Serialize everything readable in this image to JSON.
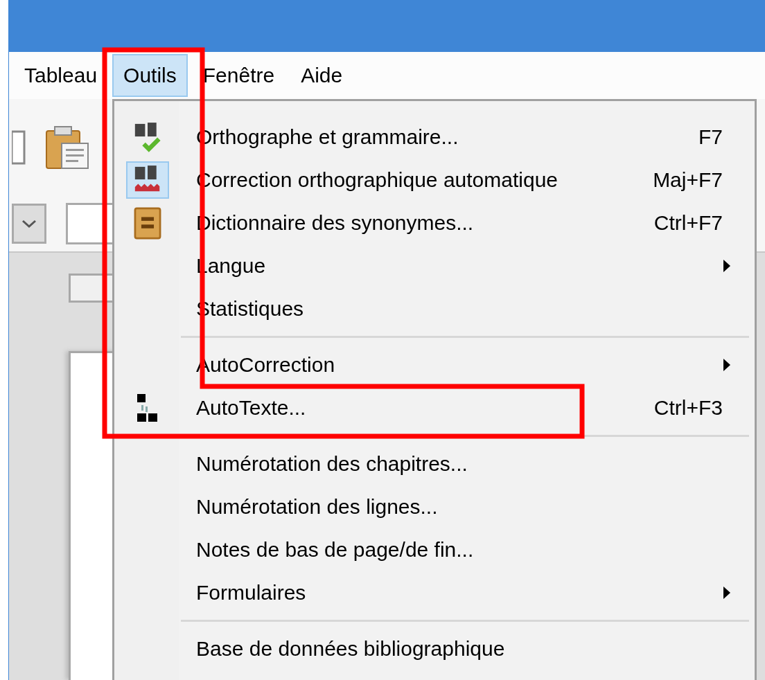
{
  "menubar": [
    {
      "label": "Tableau",
      "selected": false
    },
    {
      "label": "Outils",
      "selected": true
    },
    {
      "label": "Fenêtre",
      "selected": false
    },
    {
      "label": "Aide",
      "selected": false
    }
  ],
  "menu": {
    "items": [
      {
        "kind": "item",
        "label": "Orthographe et grammaire...",
        "shortcut": "F7",
        "checked": false,
        "submenu": false
      },
      {
        "kind": "item",
        "label": "Correction orthographique automatique",
        "shortcut": "Maj+F7",
        "checked": true,
        "submenu": false
      },
      {
        "kind": "item",
        "label": "Dictionnaire des synonymes...",
        "shortcut": "Ctrl+F7",
        "checked": false,
        "submenu": false
      },
      {
        "kind": "item",
        "label": "Langue",
        "checked": false,
        "submenu": true
      },
      {
        "kind": "item",
        "label": "Statistiques",
        "checked": false,
        "submenu": false
      },
      {
        "kind": "separator"
      },
      {
        "kind": "item",
        "label": "AutoCorrection",
        "checked": false,
        "submenu": true
      },
      {
        "kind": "item",
        "label": "AutoTexte...",
        "shortcut": "Ctrl+F3",
        "checked": false,
        "submenu": false
      },
      {
        "kind": "separator"
      },
      {
        "kind": "item",
        "label": "Numérotation des chapitres...",
        "checked": false,
        "submenu": false
      },
      {
        "kind": "item",
        "label": "Numérotation des lignes...",
        "checked": false,
        "submenu": false
      },
      {
        "kind": "item",
        "label": "Notes de bas de page/de fin...",
        "checked": false,
        "submenu": false
      },
      {
        "kind": "item",
        "label": "Formulaires",
        "checked": false,
        "submenu": true
      },
      {
        "kind": "separator"
      },
      {
        "kind": "item",
        "label": "Base de données bibliographique",
        "checked": false,
        "submenu": false
      }
    ]
  }
}
